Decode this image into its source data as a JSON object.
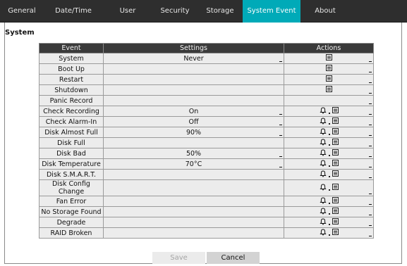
{
  "tabs": [
    {
      "label": "General"
    },
    {
      "label": "Date/Time"
    },
    {
      "label": "User"
    },
    {
      "label": "Security"
    },
    {
      "label": "Storage"
    },
    {
      "label": "System Event",
      "active": true
    },
    {
      "label": "About"
    }
  ],
  "section_title": "System",
  "table": {
    "headers": {
      "event": "Event",
      "settings": "Settings",
      "actions": "Actions"
    },
    "rows": [
      {
        "event": "System",
        "settings": "Never",
        "settings_dropdown": true,
        "bell": false,
        "log": true
      },
      {
        "event": "Boot Up",
        "settings": "",
        "settings_dropdown": false,
        "bell": false,
        "log": true
      },
      {
        "event": "Restart",
        "settings": "",
        "settings_dropdown": false,
        "bell": false,
        "log": true
      },
      {
        "event": "Shutdown",
        "settings": "",
        "settings_dropdown": false,
        "bell": false,
        "log": true
      },
      {
        "event": "Panic Record",
        "settings": "",
        "settings_dropdown": false,
        "bell": false,
        "log": false
      },
      {
        "event": "Check Recording",
        "settings": "On",
        "settings_dropdown": true,
        "bell": true,
        "log": true
      },
      {
        "event": "Check Alarm-In",
        "settings": "Off",
        "settings_dropdown": true,
        "bell": true,
        "log": true
      },
      {
        "event": "Disk Almost Full",
        "settings": "90%",
        "settings_dropdown": true,
        "bell": true,
        "log": true
      },
      {
        "event": "Disk Full",
        "settings": "",
        "settings_dropdown": false,
        "bell": true,
        "log": true
      },
      {
        "event": "Disk Bad",
        "settings": "50%",
        "settings_dropdown": true,
        "bell": true,
        "log": true
      },
      {
        "event": "Disk Temperature",
        "settings": "70°C",
        "settings_dropdown": true,
        "bell": true,
        "log": true
      },
      {
        "event": "Disk S.M.A.R.T.",
        "settings": "",
        "settings_dropdown": false,
        "bell": true,
        "log": true
      },
      {
        "event": "Disk Config Change",
        "settings": "",
        "settings_dropdown": false,
        "bell": true,
        "log": true
      },
      {
        "event": "Fan Error",
        "settings": "",
        "settings_dropdown": false,
        "bell": true,
        "log": true
      },
      {
        "event": "No Storage Found",
        "settings": "",
        "settings_dropdown": false,
        "bell": true,
        "log": true
      },
      {
        "event": "Degrade",
        "settings": "",
        "settings_dropdown": false,
        "bell": true,
        "log": true
      },
      {
        "event": "RAID Broken",
        "settings": "",
        "settings_dropdown": false,
        "bell": true,
        "log": true
      }
    ]
  },
  "buttons": {
    "save": "Save",
    "cancel": "Cancel"
  },
  "icons": {
    "bell": "bell-icon",
    "log": "log-list-icon",
    "dropdown": "dropdown-indicator-icon"
  },
  "colors": {
    "tab_bar": "#2e2e2e",
    "active_tab": "#00aab8",
    "header": "#3a3a3a",
    "cell": "#ececec"
  }
}
